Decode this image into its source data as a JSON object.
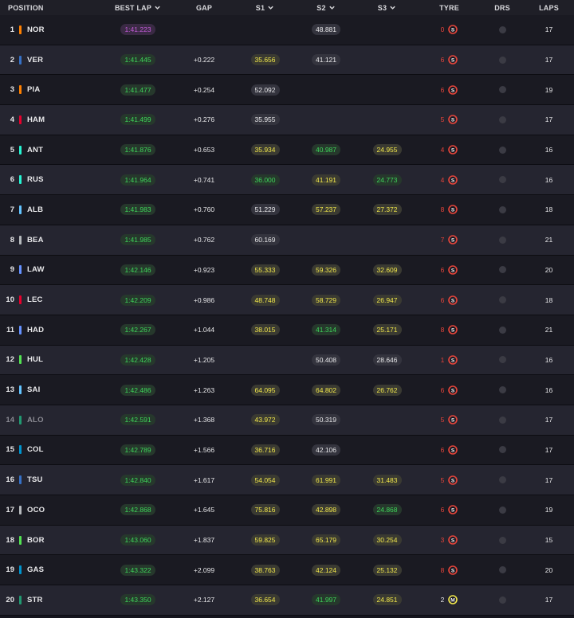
{
  "headers": {
    "position": "POSITION",
    "best_lap": "BEST LAP",
    "gap": "GAP",
    "s1": "S1",
    "s2": "S2",
    "s3": "S3",
    "tyre": "TYRE",
    "drs": "DRS",
    "laps": "LAPS"
  },
  "colors": {
    "purple": "#c35bd8",
    "green": "#3ed55a",
    "yellow": "#f2e84b",
    "soft_tyre": "#e5443a",
    "medium_tyre": "#f2e84b"
  },
  "rows": [
    {
      "pos": "1",
      "code": "NOR",
      "team_color": "#ff8000",
      "best_lap": "1:41.223",
      "best_style": "purple",
      "gap": "",
      "s1": "",
      "s1_style": "",
      "s2": "48.881",
      "s2_style": "white",
      "s3": "",
      "s3_style": "",
      "tyre_age": "0",
      "tyre": "S",
      "drs": "off",
      "laps": "17"
    },
    {
      "pos": "2",
      "code": "VER",
      "team_color": "#3671c6",
      "best_lap": "1:41.445",
      "best_style": "green",
      "gap": "+0.222",
      "s1": "35.656",
      "s1_style": "yellow",
      "s2": "41.121",
      "s2_style": "white",
      "s3": "",
      "s3_style": "",
      "tyre_age": "6",
      "tyre": "S",
      "drs": "off",
      "laps": "17"
    },
    {
      "pos": "3",
      "code": "PIA",
      "team_color": "#ff8000",
      "best_lap": "1:41.477",
      "best_style": "green",
      "gap": "+0.254",
      "s1": "52.092",
      "s1_style": "white",
      "s2": "",
      "s2_style": "",
      "s3": "",
      "s3_style": "",
      "tyre_age": "6",
      "tyre": "S",
      "drs": "off",
      "laps": "19"
    },
    {
      "pos": "4",
      "code": "HAM",
      "team_color": "#e8002d",
      "best_lap": "1:41.499",
      "best_style": "green",
      "gap": "+0.276",
      "s1": "35.955",
      "s1_style": "white",
      "s2": "",
      "s2_style": "",
      "s3": "",
      "s3_style": "",
      "tyre_age": "5",
      "tyre": "S",
      "drs": "off",
      "laps": "17"
    },
    {
      "pos": "5",
      "code": "ANT",
      "team_color": "#27f4d2",
      "best_lap": "1:41.876",
      "best_style": "green",
      "gap": "+0.653",
      "s1": "35.934",
      "s1_style": "yellow",
      "s2": "40.987",
      "s2_style": "green",
      "s3": "24.955",
      "s3_style": "yellow",
      "tyre_age": "4",
      "tyre": "S",
      "drs": "off",
      "laps": "16"
    },
    {
      "pos": "6",
      "code": "RUS",
      "team_color": "#27f4d2",
      "best_lap": "1:41.964",
      "best_style": "green",
      "gap": "+0.741",
      "s1": "36.000",
      "s1_style": "green",
      "s2": "41.191",
      "s2_style": "yellow",
      "s3": "24.773",
      "s3_style": "green",
      "tyre_age": "4",
      "tyre": "S",
      "drs": "off",
      "laps": "16"
    },
    {
      "pos": "7",
      "code": "ALB",
      "team_color": "#64c4ff",
      "best_lap": "1:41.983",
      "best_style": "green",
      "gap": "+0.760",
      "s1": "51.229",
      "s1_style": "white",
      "s2": "57.237",
      "s2_style": "yellow",
      "s3": "27.372",
      "s3_style": "yellow",
      "tyre_age": "8",
      "tyre": "S",
      "drs": "off",
      "laps": "18"
    },
    {
      "pos": "8",
      "code": "BEA",
      "team_color": "#b6babd",
      "best_lap": "1:41.985",
      "best_style": "green",
      "gap": "+0.762",
      "s1": "60.169",
      "s1_style": "white",
      "s2": "",
      "s2_style": "",
      "s3": "",
      "s3_style": "",
      "tyre_age": "7",
      "tyre": "S",
      "drs": "off",
      "laps": "21"
    },
    {
      "pos": "9",
      "code": "LAW",
      "team_color": "#6692ff",
      "best_lap": "1:42.146",
      "best_style": "green",
      "gap": "+0.923",
      "s1": "55.333",
      "s1_style": "yellow",
      "s2": "59.326",
      "s2_style": "yellow",
      "s3": "32.609",
      "s3_style": "yellow",
      "tyre_age": "6",
      "tyre": "S",
      "drs": "off",
      "laps": "20"
    },
    {
      "pos": "10",
      "code": "LEC",
      "team_color": "#e8002d",
      "best_lap": "1:42.209",
      "best_style": "green",
      "gap": "+0.986",
      "s1": "48.748",
      "s1_style": "yellow",
      "s2": "58.729",
      "s2_style": "yellow",
      "s3": "26.947",
      "s3_style": "yellow",
      "tyre_age": "6",
      "tyre": "S",
      "drs": "off",
      "laps": "18"
    },
    {
      "pos": "11",
      "code": "HAD",
      "team_color": "#6692ff",
      "best_lap": "1:42.267",
      "best_style": "green",
      "gap": "+1.044",
      "s1": "38.015",
      "s1_style": "yellow",
      "s2": "41.314",
      "s2_style": "green",
      "s3": "25.171",
      "s3_style": "yellow",
      "tyre_age": "8",
      "tyre": "S",
      "drs": "off",
      "laps": "21"
    },
    {
      "pos": "12",
      "code": "HUL",
      "team_color": "#52e252",
      "best_lap": "1:42.428",
      "best_style": "green",
      "gap": "+1.205",
      "s1": "",
      "s1_style": "",
      "s2": "50.408",
      "s2_style": "white",
      "s3": "28.646",
      "s3_style": "white",
      "tyre_age": "1",
      "tyre": "S",
      "drs": "off",
      "laps": "16"
    },
    {
      "pos": "13",
      "code": "SAI",
      "team_color": "#64c4ff",
      "best_lap": "1:42.486",
      "best_style": "green",
      "gap": "+1.263",
      "s1": "64.095",
      "s1_style": "yellow",
      "s2": "64.802",
      "s2_style": "yellow",
      "s3": "26.762",
      "s3_style": "yellow",
      "tyre_age": "6",
      "tyre": "S",
      "drs": "off",
      "laps": "16"
    },
    {
      "pos": "14",
      "code": "ALO",
      "team_color": "#229971",
      "best_lap": "1:42.591",
      "best_style": "green",
      "gap": "+1.368",
      "s1": "43.972",
      "s1_style": "yellow",
      "s2": "50.319",
      "s2_style": "white",
      "s3": "",
      "s3_style": "",
      "tyre_age": "5",
      "tyre": "S",
      "drs": "off",
      "laps": "17",
      "dim": true
    },
    {
      "pos": "15",
      "code": "COL",
      "team_color": "#0093cc",
      "best_lap": "1:42.789",
      "best_style": "green",
      "gap": "+1.566",
      "s1": "36.716",
      "s1_style": "yellow",
      "s2": "42.106",
      "s2_style": "white",
      "s3": "",
      "s3_style": "",
      "tyre_age": "6",
      "tyre": "S",
      "drs": "off",
      "laps": "17"
    },
    {
      "pos": "16",
      "code": "TSU",
      "team_color": "#3671c6",
      "best_lap": "1:42.840",
      "best_style": "green",
      "gap": "+1.617",
      "s1": "54.054",
      "s1_style": "yellow",
      "s2": "61.991",
      "s2_style": "yellow",
      "s3": "31.483",
      "s3_style": "yellow",
      "tyre_age": "5",
      "tyre": "S",
      "drs": "off",
      "laps": "17"
    },
    {
      "pos": "17",
      "code": "OCO",
      "team_color": "#b6babd",
      "best_lap": "1:42.868",
      "best_style": "green",
      "gap": "+1.645",
      "s1": "75.816",
      "s1_style": "yellow",
      "s2": "42.898",
      "s2_style": "yellow",
      "s3": "24.868",
      "s3_style": "green",
      "tyre_age": "6",
      "tyre": "S",
      "drs": "off",
      "laps": "19"
    },
    {
      "pos": "18",
      "code": "BOR",
      "team_color": "#52e252",
      "best_lap": "1:43.060",
      "best_style": "green",
      "gap": "+1.837",
      "s1": "59.825",
      "s1_style": "yellow",
      "s2": "65.179",
      "s2_style": "yellow",
      "s3": "30.254",
      "s3_style": "yellow",
      "tyre_age": "3",
      "tyre": "S",
      "drs": "off",
      "laps": "15"
    },
    {
      "pos": "19",
      "code": "GAS",
      "team_color": "#0093cc",
      "best_lap": "1:43.322",
      "best_style": "green",
      "gap": "+2.099",
      "s1": "38.763",
      "s1_style": "yellow",
      "s2": "42.124",
      "s2_style": "yellow",
      "s3": "25.132",
      "s3_style": "yellow",
      "tyre_age": "8",
      "tyre": "S",
      "drs": "off",
      "laps": "20"
    },
    {
      "pos": "20",
      "code": "STR",
      "team_color": "#229971",
      "best_lap": "1:43.350",
      "best_style": "green",
      "gap": "+2.127",
      "s1": "36.654",
      "s1_style": "yellow",
      "s2": "41.997",
      "s2_style": "green",
      "s3": "24.851",
      "s3_style": "yellow",
      "tyre_age": "2",
      "tyre": "M",
      "drs": "off",
      "laps": "17"
    }
  ]
}
